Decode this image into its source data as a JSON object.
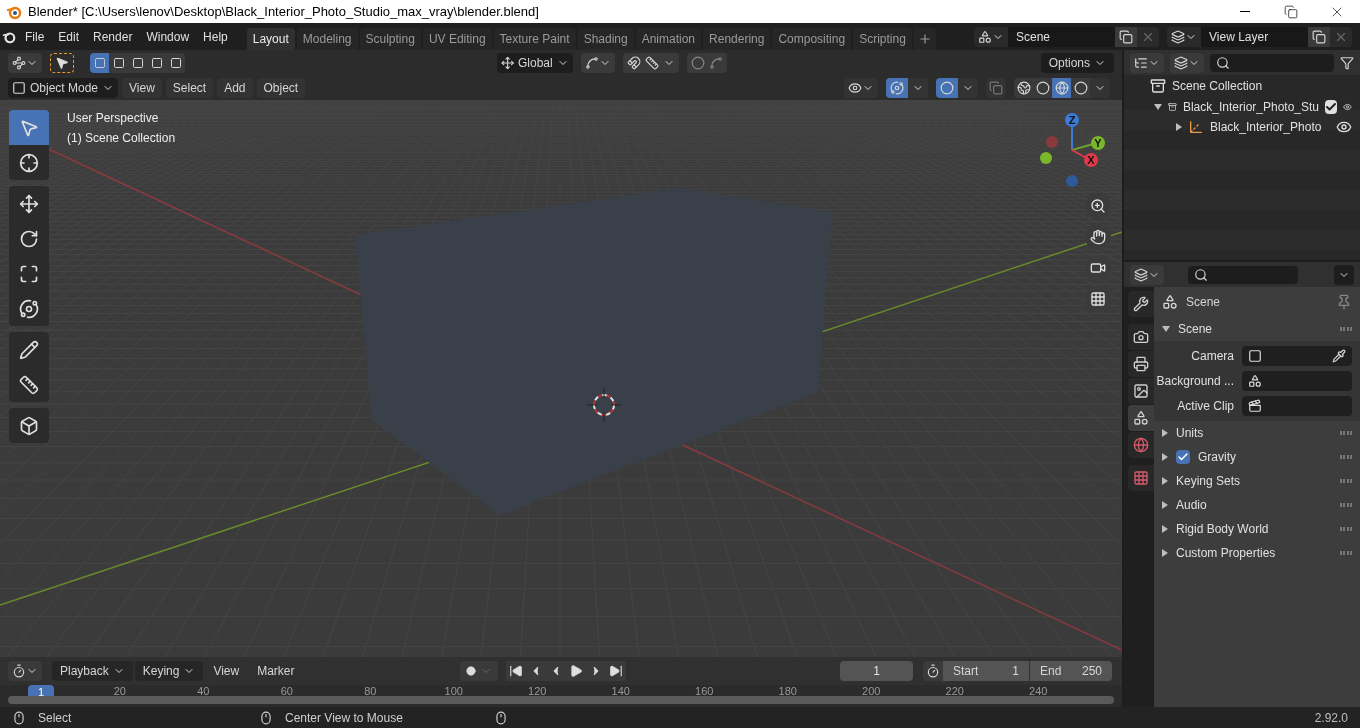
{
  "window": {
    "title": "Blender* [C:\\Users\\lenov\\Desktop\\Black_Interior_Photo_Studio_max_vray\\blender.blend]"
  },
  "menu": [
    "File",
    "Edit",
    "Render",
    "Window",
    "Help"
  ],
  "workspaces": [
    {
      "label": "Layout",
      "selected": true
    },
    {
      "label": "Modeling",
      "selected": false
    },
    {
      "label": "Sculpting",
      "selected": false
    },
    {
      "label": "UV Editing",
      "selected": false
    },
    {
      "label": "Texture Paint",
      "selected": false
    },
    {
      "label": "Shading",
      "selected": false
    },
    {
      "label": "Animation",
      "selected": false
    },
    {
      "label": "Rendering",
      "selected": false
    },
    {
      "label": "Compositing",
      "selected": false
    },
    {
      "label": "Scripting",
      "selected": false
    }
  ],
  "scene": {
    "name": "Scene"
  },
  "view_layer": {
    "name": "View Layer"
  },
  "tool_header": {
    "select_modes": [
      {
        "selected": true
      },
      {
        "selected": false
      },
      {
        "selected": false
      },
      {
        "selected": false
      },
      {
        "selected": false
      }
    ],
    "orientation": "Global",
    "options": "Options"
  },
  "viewport_header": {
    "mode": "Object Mode",
    "menus": [
      "View",
      "Select",
      "Add",
      "Object"
    ],
    "gizmos_on": true,
    "overlays_on": true,
    "xray_on": false,
    "shading_modes": [
      {
        "selected": false
      },
      {
        "selected": false
      },
      {
        "selected": true
      },
      {
        "selected": false
      }
    ]
  },
  "viewport": {
    "view_name": "User Perspective",
    "collection": "(1) Scene Collection",
    "axes": [
      "Z",
      "Y",
      "X"
    ]
  },
  "tool_groups": [
    [
      {
        "selected": true
      },
      {
        "selected": false
      }
    ],
    [
      {
        "selected": false
      },
      {
        "selected": false
      },
      {
        "selected": false
      },
      {
        "selected": false
      }
    ],
    [
      {
        "selected": false
      },
      {
        "selected": false
      }
    ],
    [
      {
        "selected": false
      }
    ]
  ],
  "outliner": {
    "root": "Scene Collection",
    "items": [
      {
        "label": "Black_Interior_Photo_Stu",
        "expanded": true,
        "checked": true,
        "children": [
          {
            "label": "Black_Interior_Photo",
            "expanded": false
          }
        ]
      }
    ]
  },
  "properties": {
    "context": "Scene",
    "tabs": [
      {
        "selected": false
      },
      {
        "selected": false
      },
      {
        "selected": false
      },
      {
        "selected": false
      },
      {
        "selected": true
      },
      {
        "selected": false
      },
      {
        "selected": false
      }
    ],
    "panels": [
      {
        "title": "Scene",
        "kind": "plain",
        "expanded": true,
        "fields": [
          {
            "label": "Camera",
            "kind": "object"
          },
          {
            "label": "Background ...",
            "kind": "scene"
          },
          {
            "label": "Active Clip",
            "kind": "clip"
          }
        ]
      },
      {
        "title": "Units",
        "kind": "plain",
        "expanded": false
      },
      {
        "title": "Gravity",
        "kind": "checkbox",
        "checked": true,
        "expanded": false
      },
      {
        "title": "Keying Sets",
        "kind": "plain",
        "expanded": false
      },
      {
        "title": "Audio",
        "kind": "plain",
        "expanded": false
      },
      {
        "title": "Rigid Body World",
        "kind": "plain",
        "expanded": false
      },
      {
        "title": "Custom Properties",
        "kind": "plain",
        "expanded": false
      }
    ]
  },
  "timeline": {
    "menus": [
      {
        "label": "Playback",
        "kind": "dropdown"
      },
      {
        "label": "Keying",
        "kind": "dropdown"
      },
      {
        "label": "View",
        "kind": "plain"
      },
      {
        "label": "Marker",
        "kind": "plain"
      }
    ],
    "current_frame": "1",
    "start_label": "Start",
    "start": "1",
    "end_label": "End",
    "end": "250",
    "playhead": "1",
    "ruler": [
      "20",
      "40",
      "60",
      "80",
      "100",
      "120",
      "140",
      "160",
      "180",
      "200",
      "220",
      "240"
    ]
  },
  "status_bar": {
    "items": [
      "Select",
      "Center View to Mouse"
    ],
    "version": "2.92.0"
  }
}
